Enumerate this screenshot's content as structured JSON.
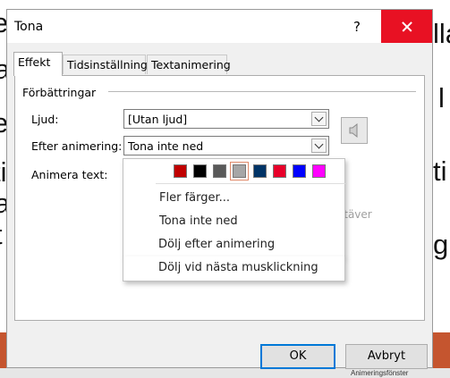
{
  "background": {
    "left_fragments": [
      "e",
      "a",
      "e",
      "ti",
      "a",
      "t"
    ],
    "right_fragments": [
      "lla",
      "l",
      "ti",
      "gu"
    ]
  },
  "dialog": {
    "title": "Tona",
    "help_label": "?",
    "tabs": [
      {
        "label": "Effekt",
        "active": true
      },
      {
        "label": "Tidsinställning",
        "active": false
      },
      {
        "label": "Textanimering",
        "active": false
      }
    ],
    "group_label": "Förbättringar",
    "sound_label": "Ljud:",
    "sound_value": "[Utan ljud]",
    "after_animation_label": "Efter animering:",
    "after_animation_value": "Tona inte ned",
    "animate_text_label": "Animera text:",
    "faded_text": "stäver",
    "dropdown": {
      "swatches": [
        "#c00000",
        "#000000",
        "#595959",
        "#a6a6a6",
        "#003366",
        "#e8002a",
        "#0000ff",
        "#ff00ff"
      ],
      "selected_swatch_index": 3,
      "items": [
        "Fler färger...",
        "Tona inte ned",
        "Dölj efter animering",
        "Dölj vid nästa musklickning"
      ]
    },
    "ok_label": "OK",
    "cancel_label": "Avbryt"
  },
  "statusbar": {
    "text": "Animeringsfönster"
  },
  "colors": {
    "close_button": "#e81123",
    "slide_band": "#c5552f",
    "default_button_border": "#0078d7"
  }
}
